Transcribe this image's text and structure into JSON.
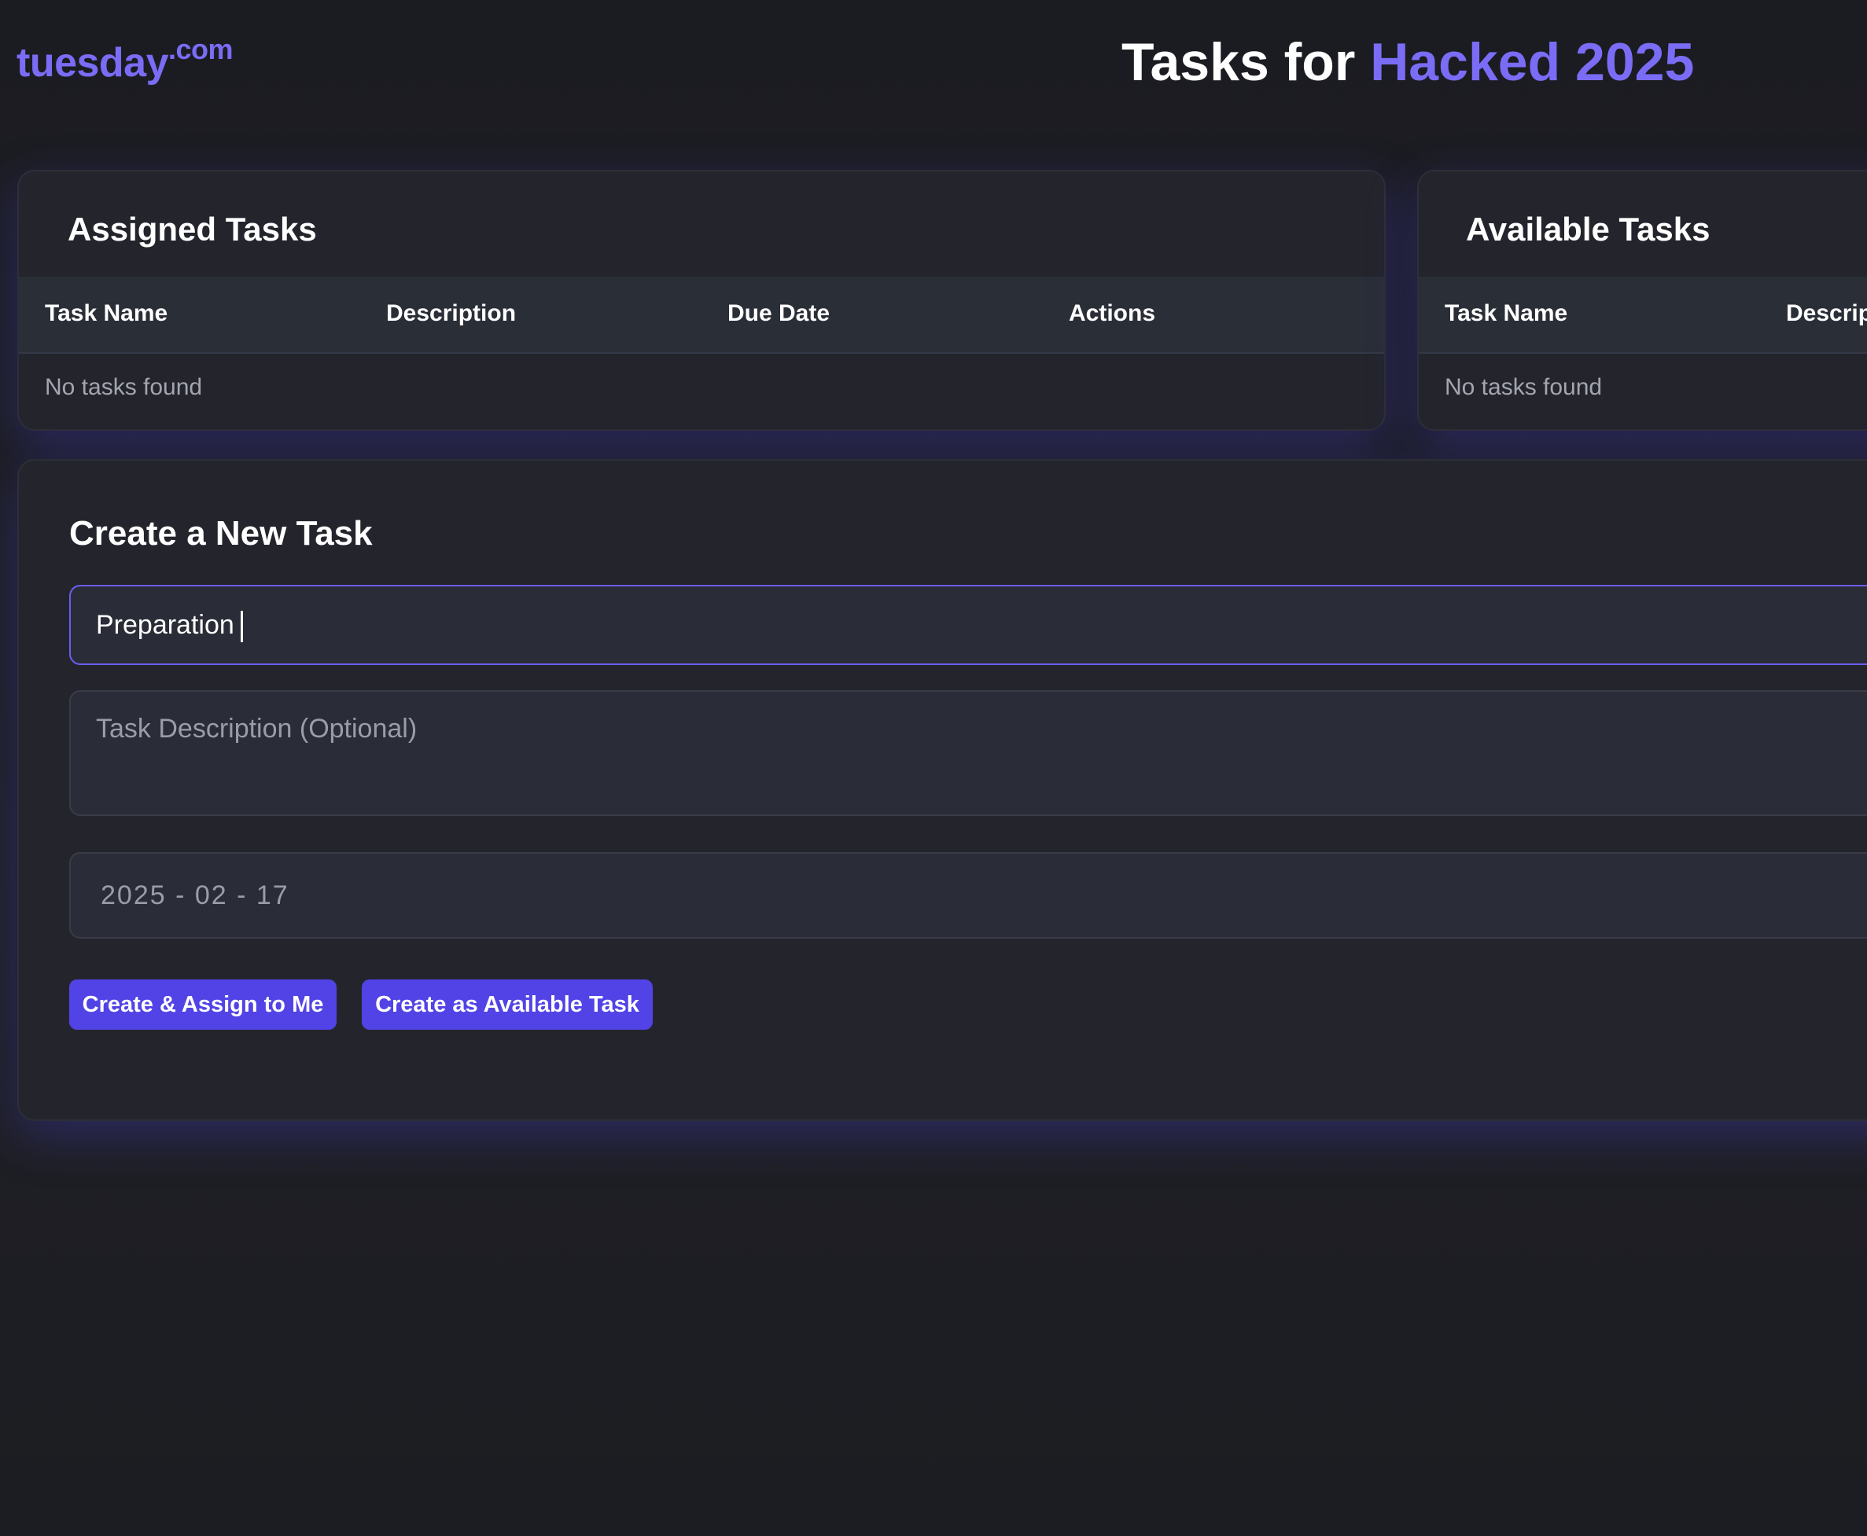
{
  "header": {
    "logo_main": "tuesday",
    "logo_tld": ".com",
    "title_prefix": "Tasks for ",
    "title_accent": "Hacked 2025"
  },
  "assigned": {
    "heading": "Assigned Tasks",
    "columns": [
      "Task Name",
      "Description",
      "Due Date",
      "Actions"
    ],
    "empty_text": "No tasks found"
  },
  "available": {
    "heading": "Available Tasks",
    "columns": [
      "Task Name",
      "Descrip"
    ],
    "empty_text": "No tasks found"
  },
  "create": {
    "heading": "Create a New Task",
    "name_value": "Preparation",
    "description_placeholder": "Task Description (Optional)",
    "due_date_value": "2025 - 02 - 17",
    "btn_assign": "Create & Assign to Me",
    "btn_available": "Create as Available Task"
  },
  "colors": {
    "accent": "#7b6cf6",
    "button": "#5143e6",
    "background": "#1c1d22",
    "card": "#24252c"
  }
}
